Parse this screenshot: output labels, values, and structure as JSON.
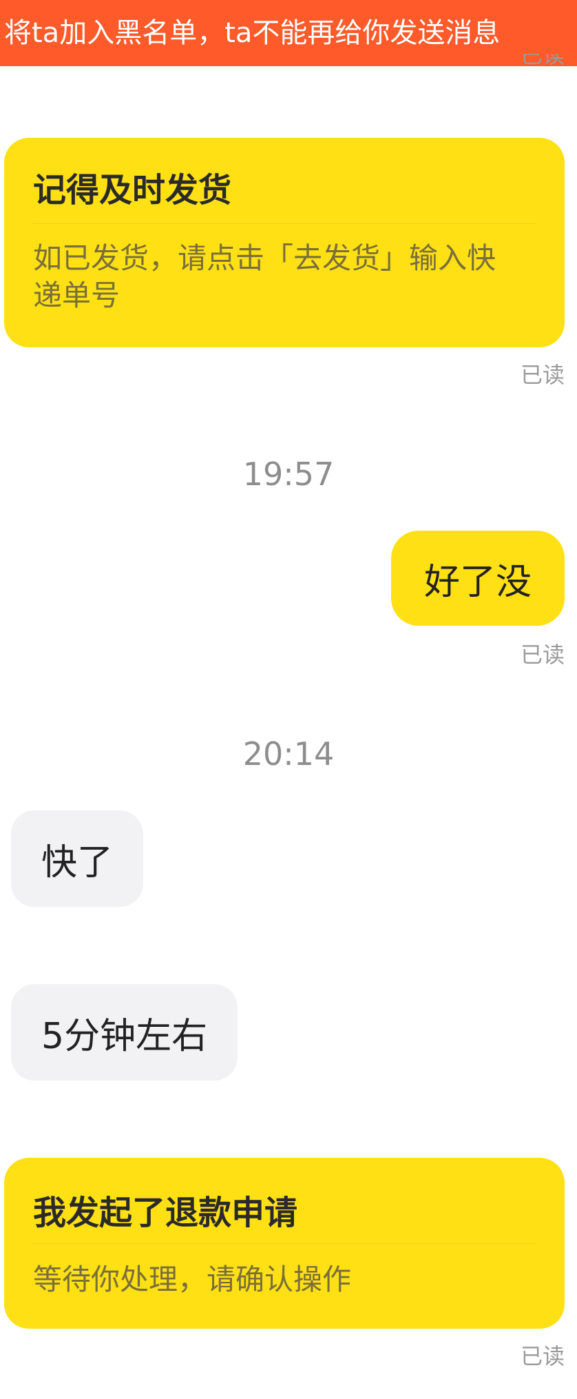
{
  "banner": {
    "text": "将ta加入黑名单，ta不能再给你发送消息"
  },
  "messages": {
    "read_label": "已读",
    "card_ship": {
      "title": "记得及时发货",
      "body": "如已发货，请点击「去发货」输入快递单号"
    },
    "time_1": "19:57",
    "out_1": "好了没",
    "time_2": "20:14",
    "in_1": "快了",
    "in_2": "5分钟左右",
    "card_refund": {
      "title": "我发起了退款申请",
      "body": "等待你处理，请确认操作"
    }
  },
  "colors": {
    "banner": "#ff5a2a",
    "bubble_yellow": "#ffe014",
    "bubble_gray": "#f2f2f5"
  }
}
